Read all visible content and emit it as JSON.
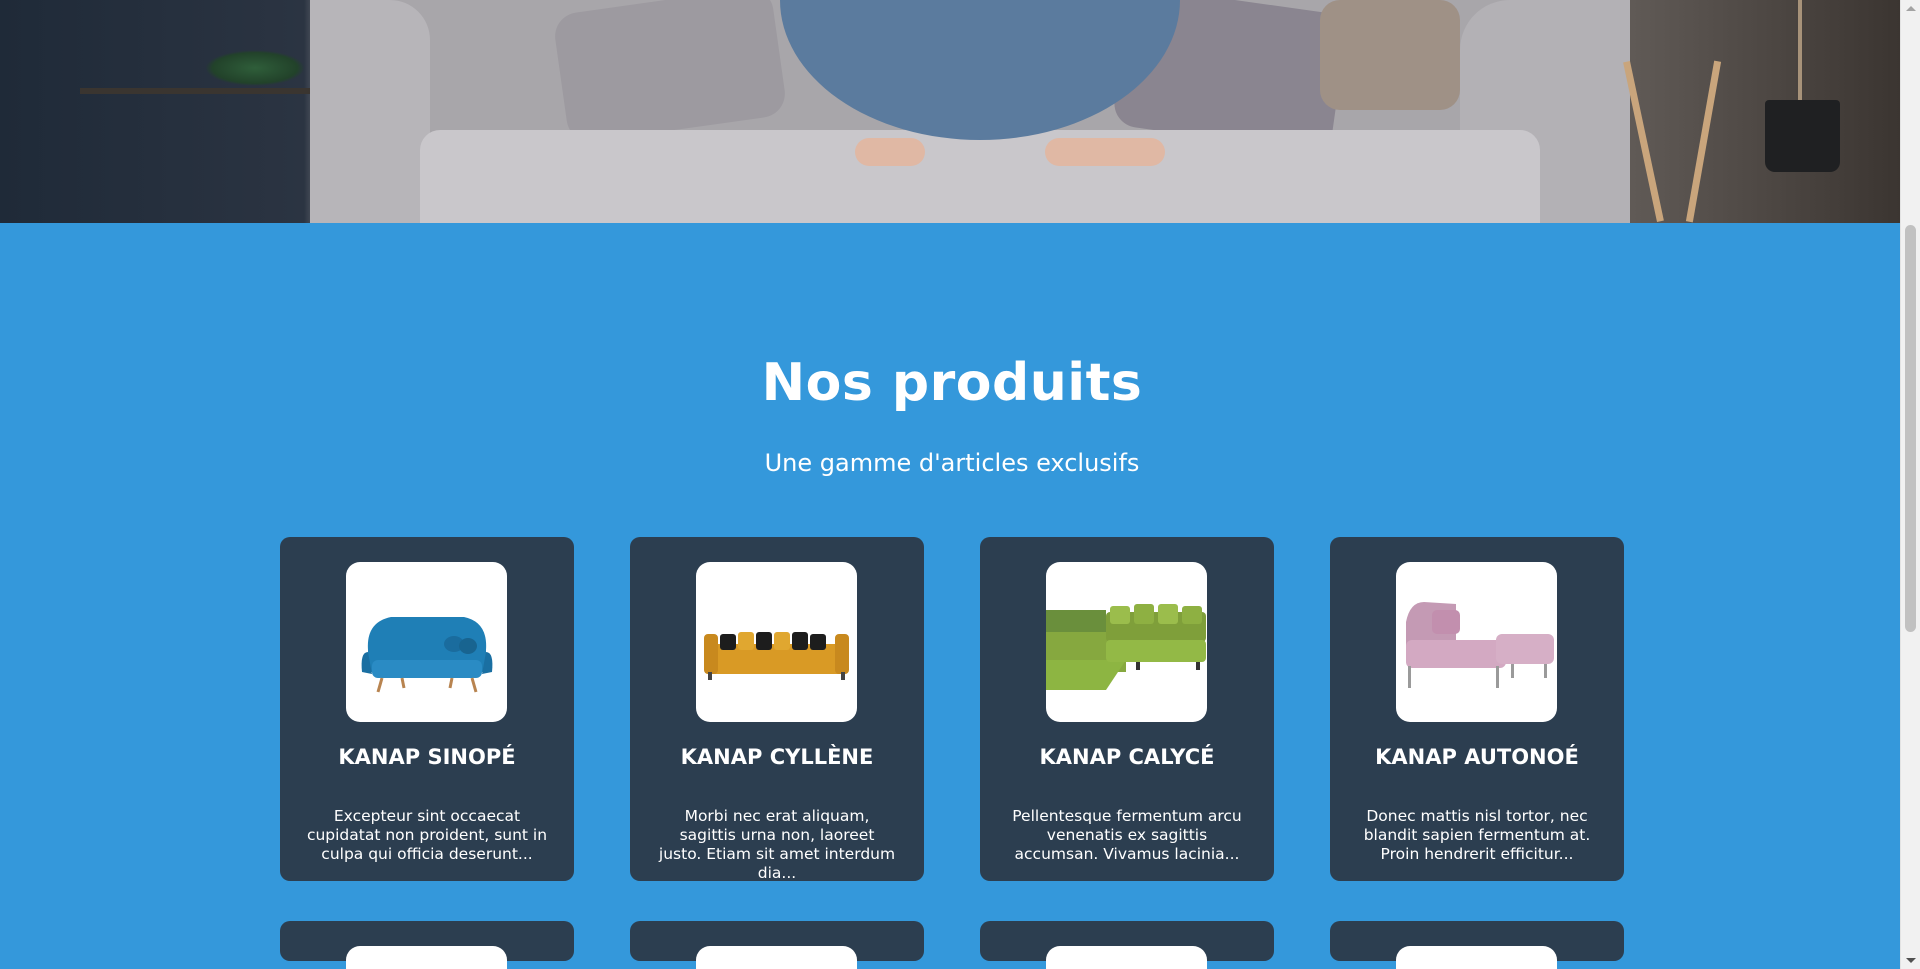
{
  "section": {
    "title": "Nos produits",
    "subtitle": "Une gamme d'articles exclusifs"
  },
  "colors": {
    "section_bg": "#3498db",
    "card_bg": "#2c3e50",
    "text": "#ffffff"
  },
  "products": [
    {
      "name": "KANAP SINOPÉ",
      "description": "Excepteur sint occaecat cupidatat non proident, sunt in culpa qui officia deserunt...",
      "image": "blue-armchair-sofa"
    },
    {
      "name": "KANAP CYLLÈNE",
      "description": "Morbi nec erat aliquam, sagittis urna non, laoreet justo. Etiam sit amet interdum dia...",
      "image": "yellow-sofa-black-pillows"
    },
    {
      "name": "KANAP CALYCÉ",
      "description": "Pellentesque fermentum arcu venenatis ex sagittis accumsan. Vivamus lacinia...",
      "image": "green-corner-sofa"
    },
    {
      "name": "KANAP AUTONOÉ",
      "description": "Donec mattis nisl tortor, nec blandit sapien fermentum at. Proin hendrerit efficitur...",
      "image": "pink-sofa-bed"
    }
  ],
  "hero": {
    "image": "woman-sitting-on-grey-sofa"
  }
}
